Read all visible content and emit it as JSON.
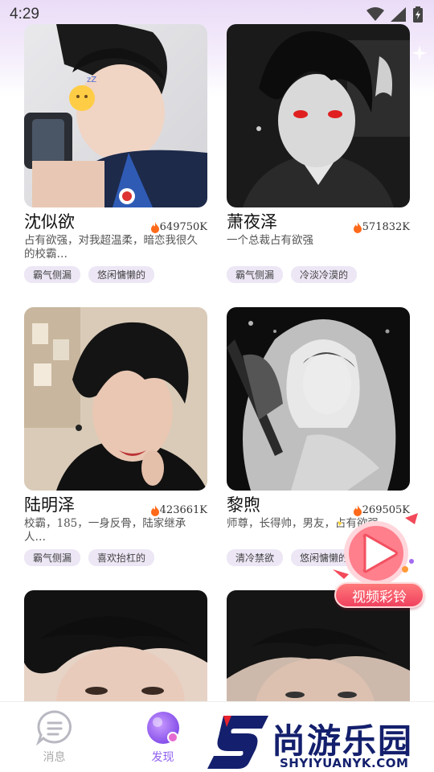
{
  "status": {
    "time": "4:29"
  },
  "cards": [
    {
      "name": "沈似欲",
      "hot": "649750K",
      "desc": "占有欲强，对我超温柔，暗恋我很久的校霸…",
      "tags": [
        "霸气侧漏",
        "悠闲慵懒的"
      ]
    },
    {
      "name": "萧夜泽",
      "hot": "571832K",
      "desc": "一个总裁占有欲强",
      "tags": [
        "霸气侧漏",
        "冷淡冷漠的"
      ]
    },
    {
      "name": "陆明泽",
      "hot": "423661K",
      "desc": "校霸，185，一身反骨，陆家继承人…",
      "tags": [
        "霸气侧漏",
        "喜欢抬杠的"
      ]
    },
    {
      "name": "黎煦",
      "hot": "269505K",
      "desc": "师尊，长得帅，男友，占有欲强",
      "tags": [
        "清冷禁欲",
        "悠闲慵懒的"
      ]
    }
  ],
  "nav": {
    "messages_label": "消息",
    "discover_label": "发现"
  },
  "fab": {
    "label": "视频彩铃"
  },
  "watermark": {
    "brand": "尚游乐园",
    "url": "SHYIYUANYK.COM"
  },
  "colors": {
    "accent": "#8f5ff0",
    "hot": "#ff6a1a",
    "tag_bg": "#ece6f5"
  }
}
